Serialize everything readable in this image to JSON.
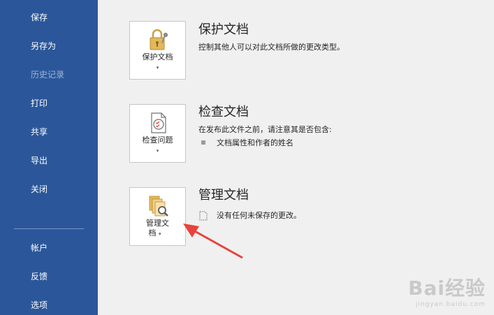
{
  "sidebar": {
    "items": [
      {
        "label": "保存",
        "enabled": true
      },
      {
        "label": "另存为",
        "enabled": true
      },
      {
        "label": "历史记录",
        "enabled": false
      },
      {
        "label": "打印",
        "enabled": true
      },
      {
        "label": "共享",
        "enabled": true
      },
      {
        "label": "导出",
        "enabled": true
      },
      {
        "label": "关闭",
        "enabled": true
      }
    ],
    "bottom_items": [
      {
        "label": "帐户"
      },
      {
        "label": "反馈"
      },
      {
        "label": "选项"
      }
    ],
    "color": "#2b579a"
  },
  "sections": {
    "protect": {
      "button_label": "保护文档",
      "title": "保护文档",
      "description": "控制其他人可以对此文档所做的更改类型。"
    },
    "inspect": {
      "button_label": "检查问题",
      "title": "检查文档",
      "description": "在发布此文件之前，请注意其是否包含:",
      "bullets": [
        "文档属性和作者的姓名"
      ]
    },
    "manage": {
      "button_label_line1": "管理文",
      "button_label_line2": "档",
      "title": "管理文档",
      "status": "没有任何未保存的更改。"
    }
  },
  "watermark": {
    "main": "Bai经验",
    "sub": "jingyan.baidu.com"
  },
  "annotation_arrow_color": "#e8423b"
}
